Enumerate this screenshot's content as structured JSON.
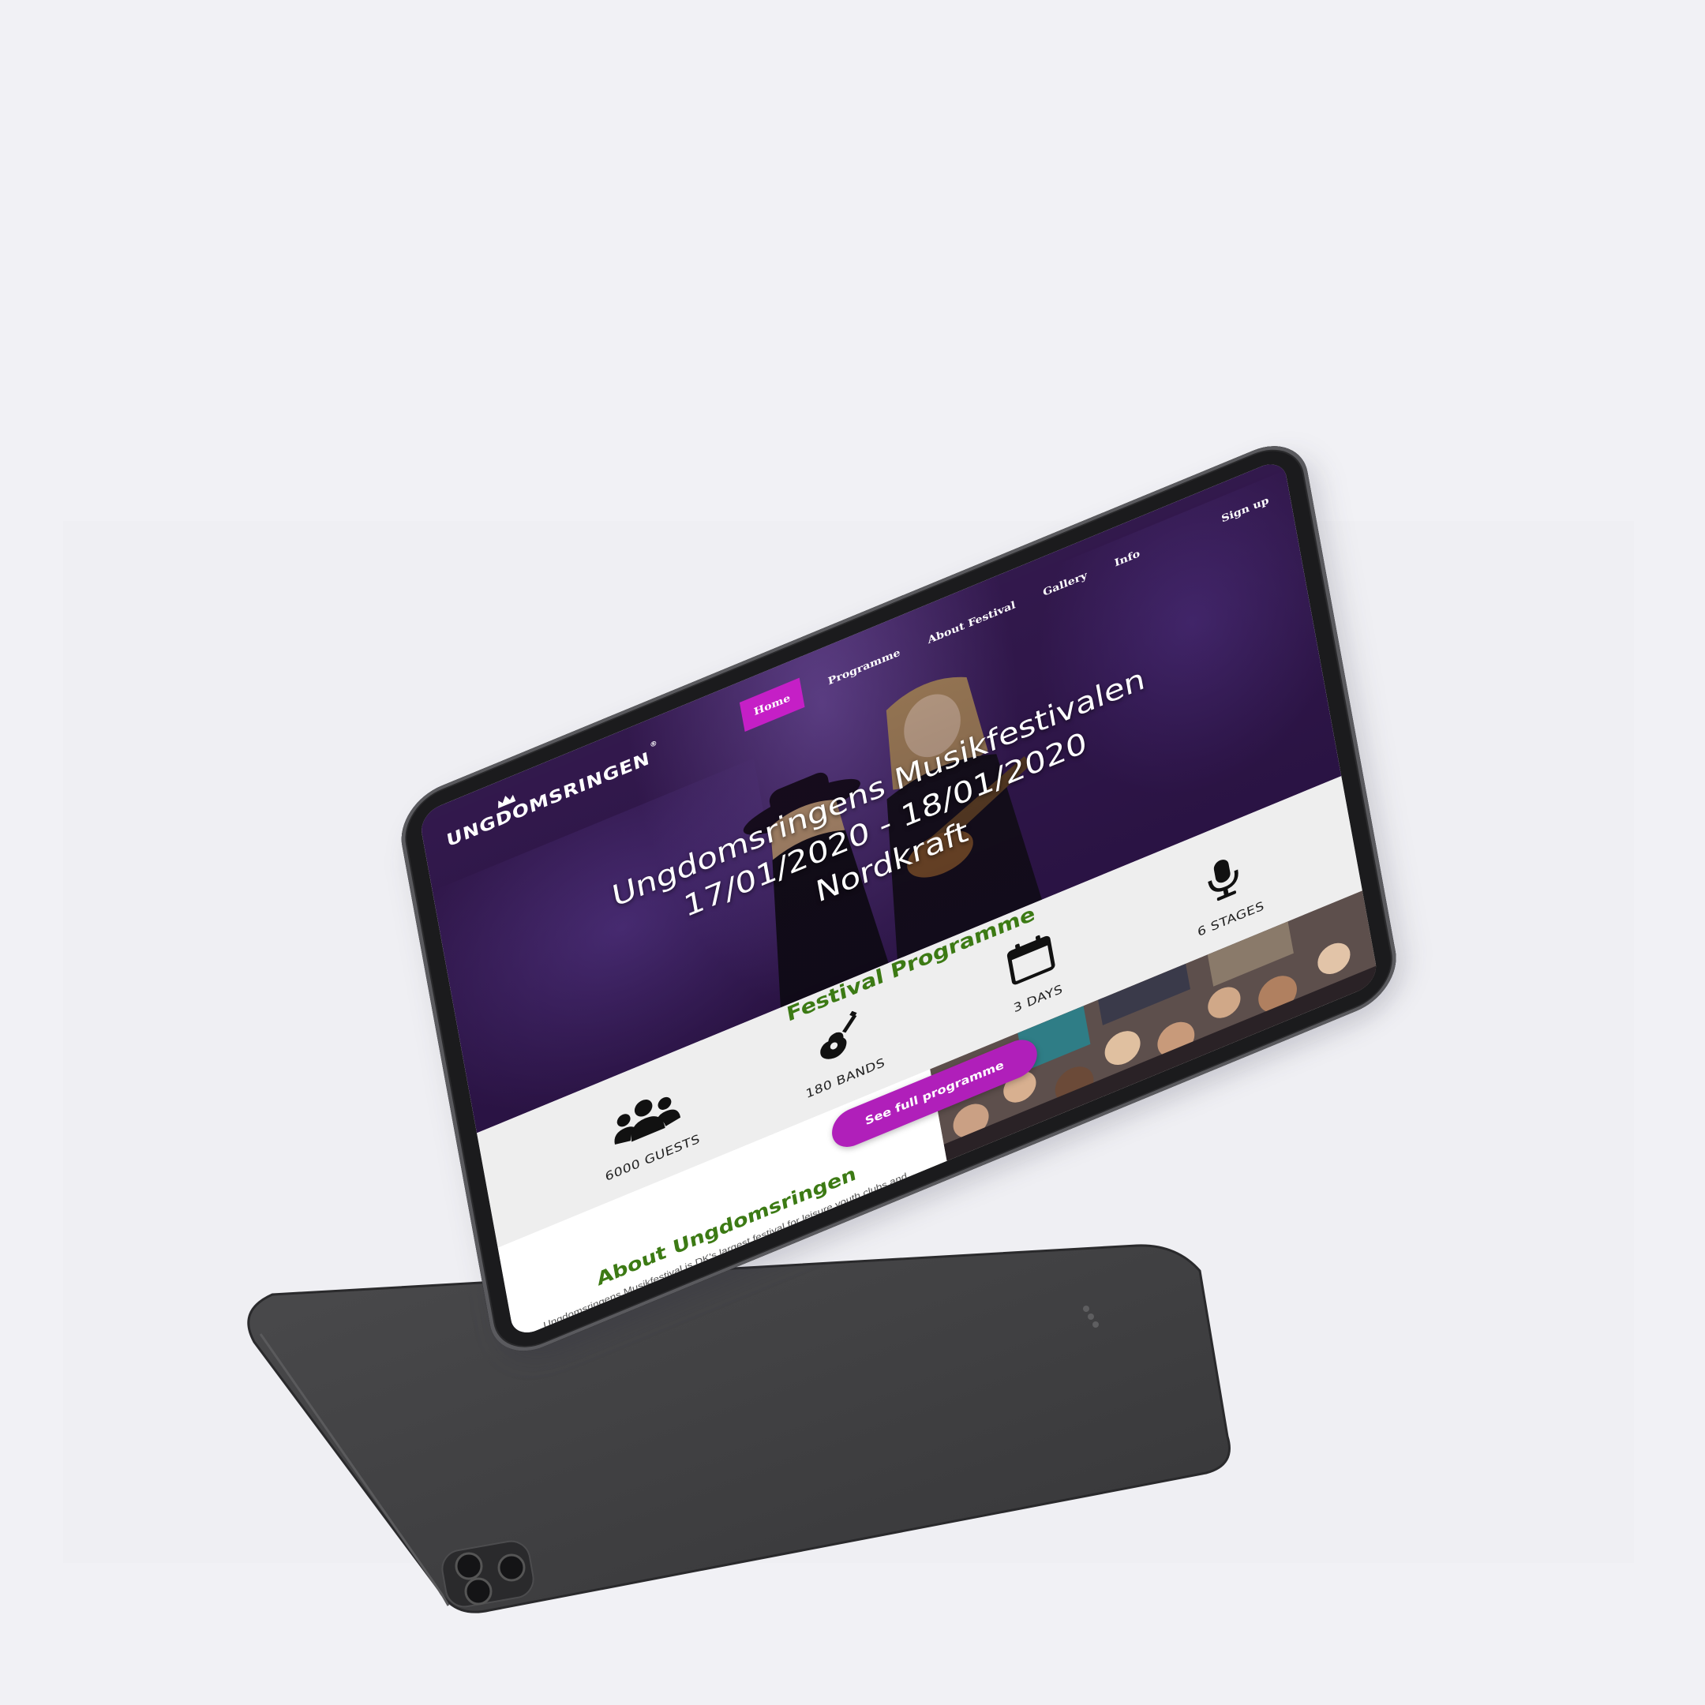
{
  "site": {
    "logo_text": "UNGDOMSRINGEN",
    "logo_reg": "®"
  },
  "nav": {
    "items": [
      {
        "label": "Home",
        "active": true
      },
      {
        "label": "Programme",
        "active": false
      },
      {
        "label": "About Festival",
        "active": false
      },
      {
        "label": "Gallery",
        "active": false
      },
      {
        "label": "Info",
        "active": false
      }
    ],
    "signup_label": "Sign up"
  },
  "hero": {
    "title_line1": "Ungdomsringens Musikfestivalen",
    "title_line2": "17/01/2020 - 18/01/2020",
    "title_line3": "Nordkraft"
  },
  "programme": {
    "title": "Festival Programme",
    "stats": [
      {
        "icon": "users-icon",
        "label": "6000 GUESTS"
      },
      {
        "icon": "guitar-icon",
        "label": "180 BANDS"
      },
      {
        "icon": "calendar-icon",
        "label": "3 DAYS"
      },
      {
        "icon": "microphone-icon",
        "label": "6 STAGES"
      }
    ],
    "cta_label": "See full programme"
  },
  "about": {
    "title": "About Ungdomsringen",
    "text": "Ungdomsringens Musikfestival is DK's largest festival for leisure youth clubs and youth school bands."
  },
  "colors": {
    "page_background": "#f1f1f5",
    "accent_purple": "#b01fba",
    "nav_active": "#c51fc6",
    "heading_green": "#3c7a14",
    "hero_purple": "#3b1d5a",
    "device_body": "#1b1b1d",
    "back_tablet": "#3d3d3f"
  }
}
